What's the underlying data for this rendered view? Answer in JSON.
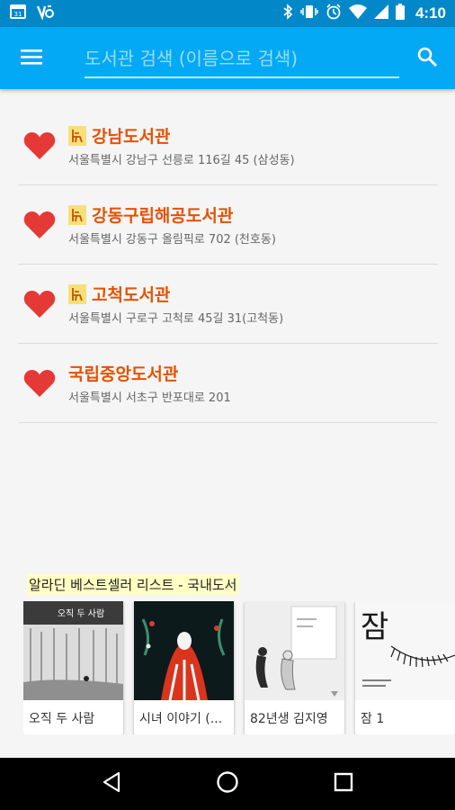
{
  "status_bar": {
    "time": "4:10"
  },
  "app_bar": {
    "search_placeholder": "도서관 검색 (이름으로 검색)"
  },
  "libraries": [
    {
      "name": "강남도서관",
      "address": "서울특별시 강남구 선릉로 116길 45 (삼성동)",
      "reading_room": true
    },
    {
      "name": "강동구립해공도서관",
      "address": "서울특별시 강동구 올림픽로 702 (천호동)",
      "reading_room": true
    },
    {
      "name": "고척도서관",
      "address": "서울특별시 구로구 고척로 45길 31(고척동)",
      "reading_room": true
    },
    {
      "name": "국립중앙도서관",
      "address": "서울특별시 서초구 반포대로 201",
      "reading_room": false
    }
  ],
  "bestseller": {
    "title": "알라딘 베스트셀러 리스트 - 국내도서",
    "books": [
      {
        "label": "오직 두 사람",
        "cover_text": "오직 두 사람"
      },
      {
        "label": "시녀 이야기 (..."
      },
      {
        "label": "82년생 김지영"
      },
      {
        "label": "잠 1",
        "cover_text": "잠"
      }
    ]
  },
  "colors": {
    "status_bar": "#0288c9",
    "app_bar": "#03a9f4",
    "library_name": "#e65100",
    "heart": "#e53935",
    "bestseller_highlight": "#ffffc4"
  }
}
